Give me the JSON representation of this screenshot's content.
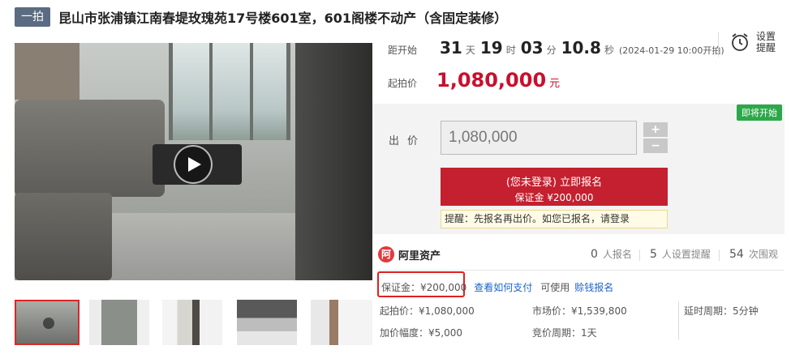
{
  "header": {
    "badge": "一拍",
    "title": "昆山市张浦镇江南春堤玫瑰苑17号楼601室，601阁楼不动产（含固定装修）"
  },
  "countdown": {
    "label": "距开始",
    "days": "31",
    "days_unit": "天",
    "hours": "19",
    "hours_unit": "时",
    "minutes": "03",
    "minutes_unit": "分",
    "seconds": "10.8",
    "seconds_unit": "秒",
    "start_time": "(2024-01-29 10:00开拍)"
  },
  "reminder": {
    "label": "设置提醒",
    "icon": "alarm-clock-icon"
  },
  "starting_price": {
    "label": "起拍价",
    "value": "1,080,000",
    "unit": "元"
  },
  "bid": {
    "status_badge": "即将开始",
    "label": "出价",
    "input_value": "1,080,000",
    "plus": "+",
    "minus": "−",
    "register_line1": "(您未登录) 立即报名",
    "register_line2": "保证金 ¥200,000",
    "tip": "提醒：先报名再出价。如您已报名，请登录"
  },
  "platform": {
    "logo_glyph": "阿",
    "name": "阿里资产",
    "registered_count": "0",
    "registered_label": "人报名",
    "reminder_count": "5",
    "reminder_label": "人设置提醒",
    "views_count": "54",
    "views_label": "次围观"
  },
  "deposit": {
    "text": "保证金：¥200,000",
    "how_to_pay": "查看如何支付",
    "usable": "可使用",
    "loan_signup": "赊钱报名"
  },
  "details": {
    "start_price": "起拍价：¥1,080,000",
    "market_price": "市场价：¥1,539,800",
    "delay_period": "延时周期：5分钟",
    "increment": "加价幅度：¥5,000",
    "bid_period": "竞价周期：1天"
  },
  "colors": {
    "accent_red": "#c4202f",
    "price_red": "#c8102e",
    "green_badge": "#2ca84a",
    "link_blue": "#1e64c8"
  }
}
